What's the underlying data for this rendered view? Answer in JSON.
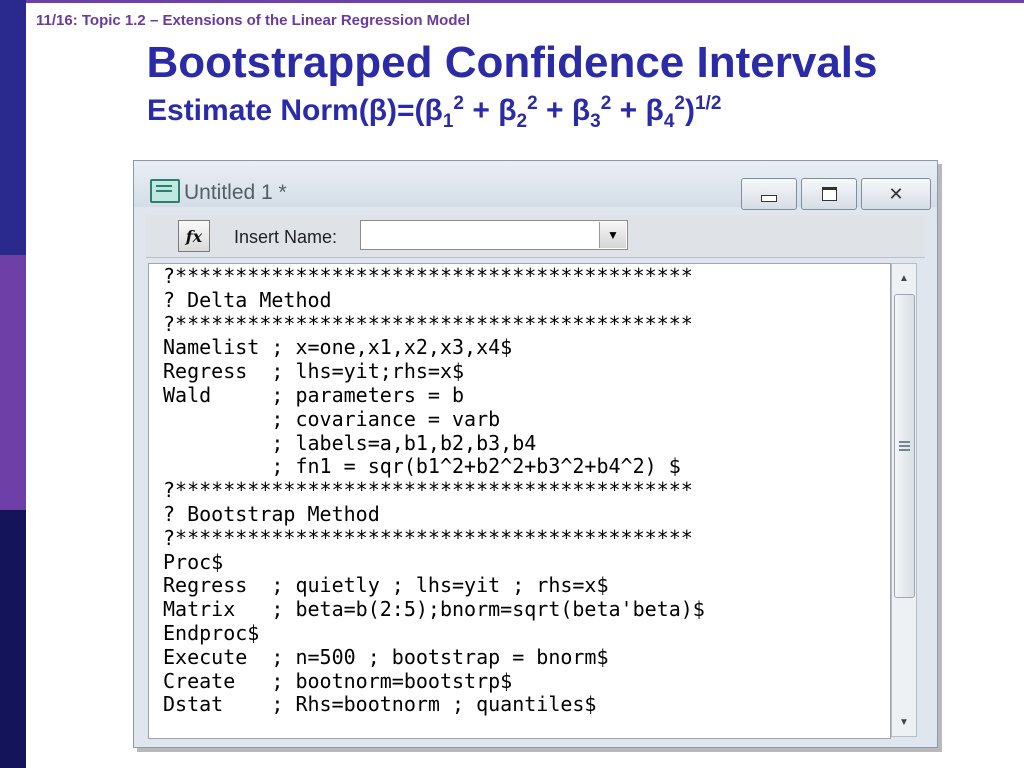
{
  "slide": {
    "breadcrumb": "11/16: Topic 1.2 – Extensions of the Linear Regression Model",
    "title": "Bootstrapped Confidence Intervals",
    "subtitle": {
      "prefix": "Estimate Norm(β)=(β",
      "s1": "1",
      "p1": "2",
      "mid1": " + β",
      "s2": "2",
      "p2": "2",
      "mid2": " + β",
      "s3": "3",
      "p3": "2",
      "mid3": " + β",
      "s4": "4",
      "p4": "2",
      "close": ")",
      "root": "1/2"
    }
  },
  "window": {
    "title": "Untitled 1 *",
    "close_label": "✕",
    "toolbar": {
      "fx_label": "fx",
      "insert_name_label": "Insert Name:",
      "insert_name_value": "",
      "dropdown_arrow": "▼"
    },
    "scroll_up": "▲",
    "scroll_down": "▼"
  },
  "code": [
    "?*******************************************",
    "? Delta Method",
    "?*******************************************",
    "Namelist ; x=one,x1,x2,x3,x4$",
    "Regress  ; lhs=yit;rhs=x$",
    "Wald     ; parameters = b",
    "         ; covariance = varb",
    "         ; labels=a,b1,b2,b3,b4",
    "         ; fn1 = sqr(b1^2+b2^2+b3^2+b4^2) $",
    "?*******************************************",
    "? Bootstrap Method",
    "?*******************************************",
    "Proc$",
    "Regress  ; quietly ; lhs=yit ; rhs=x$",
    "Matrix   ; beta=b(2:5);bnorm=sqrt(beta'beta)$",
    "Endproc$",
    "Execute  ; n=500 ; bootstrap = bnorm$",
    "Create   ; bootnorm=bootstrp$",
    "Dstat    ; Rhs=bootnorm ; quantiles$"
  ]
}
